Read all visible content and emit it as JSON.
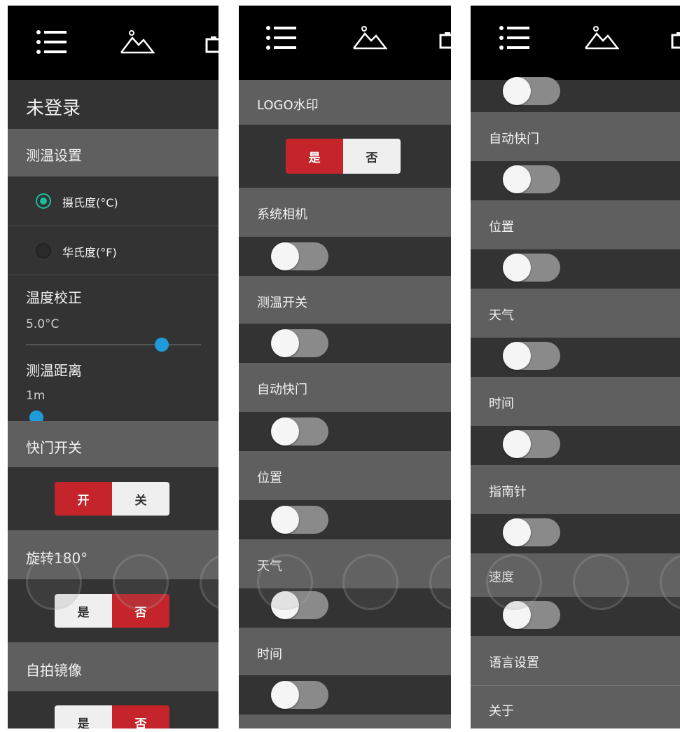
{
  "panel1": {
    "login_status": "未登录",
    "temp_settings": "测温设置",
    "celsius": "摄氏度(°C)",
    "fahrenheit": "华氏度(°F)",
    "temp_correction": "温度校正",
    "temp_correction_value": "5.0°C",
    "temp_correction_level": 0.8,
    "temp_distance": "测温距离",
    "temp_distance_value": "1m",
    "temp_distance_level": 0.02,
    "shutter_switch": "快门开关",
    "shutter_on": "开",
    "shutter_off": "关",
    "rotate": "旋转180°",
    "rotate_yes": "是",
    "rotate_no": "否",
    "selfie_mirror": "自拍镜像",
    "mirror_yes": "是",
    "mirror_no": "否"
  },
  "panel2": {
    "logo_watermark": "LOGO水印",
    "logo_yes": "是",
    "logo_no": "否",
    "system_camera": "系统相机",
    "temp_switch": "测温开关",
    "auto_shutter": "自动快门",
    "location": "位置",
    "weather": "天气",
    "time": "时间"
  },
  "panel3": {
    "auto_shutter": "自动快门",
    "location": "位置",
    "weather": "天气",
    "time": "时间",
    "compass": "指南针",
    "speed": "速度",
    "language": "语言设置",
    "about": "关于"
  },
  "colors": {
    "accent_red": "#c4242a",
    "radio_green": "#1abc9c",
    "slider_blue": "#1f9bd9"
  },
  "icons": [
    "menu-icon",
    "mountain-image-icon",
    "camera-icon"
  ]
}
